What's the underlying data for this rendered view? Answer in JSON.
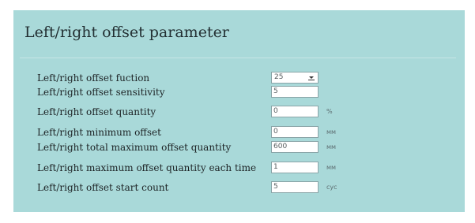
{
  "title": "Left/right offset parameter",
  "rows": [
    {
      "label": "Left/right offset fuction",
      "type": "select",
      "value": "25"
    },
    {
      "label": "Left/right offset sensitivity",
      "type": "input",
      "value": "5",
      "unit": ""
    },
    {
      "label": "Left/right offset quantity",
      "type": "input",
      "value": "0",
      "unit": "%"
    },
    {
      "label": "Left/right minimum offset",
      "type": "input",
      "value": "0",
      "unit": "мм"
    },
    {
      "label": "Left/right total maximum offset quantity",
      "type": "input",
      "value": "600",
      "unit": "мм"
    },
    {
      "label": "Left/right maximum offset quantity each time",
      "type": "input",
      "value": "1",
      "unit": "мм"
    },
    {
      "label": "Left/right offset start count",
      "type": "input",
      "value": "5",
      "unit": "cyc"
    }
  ]
}
